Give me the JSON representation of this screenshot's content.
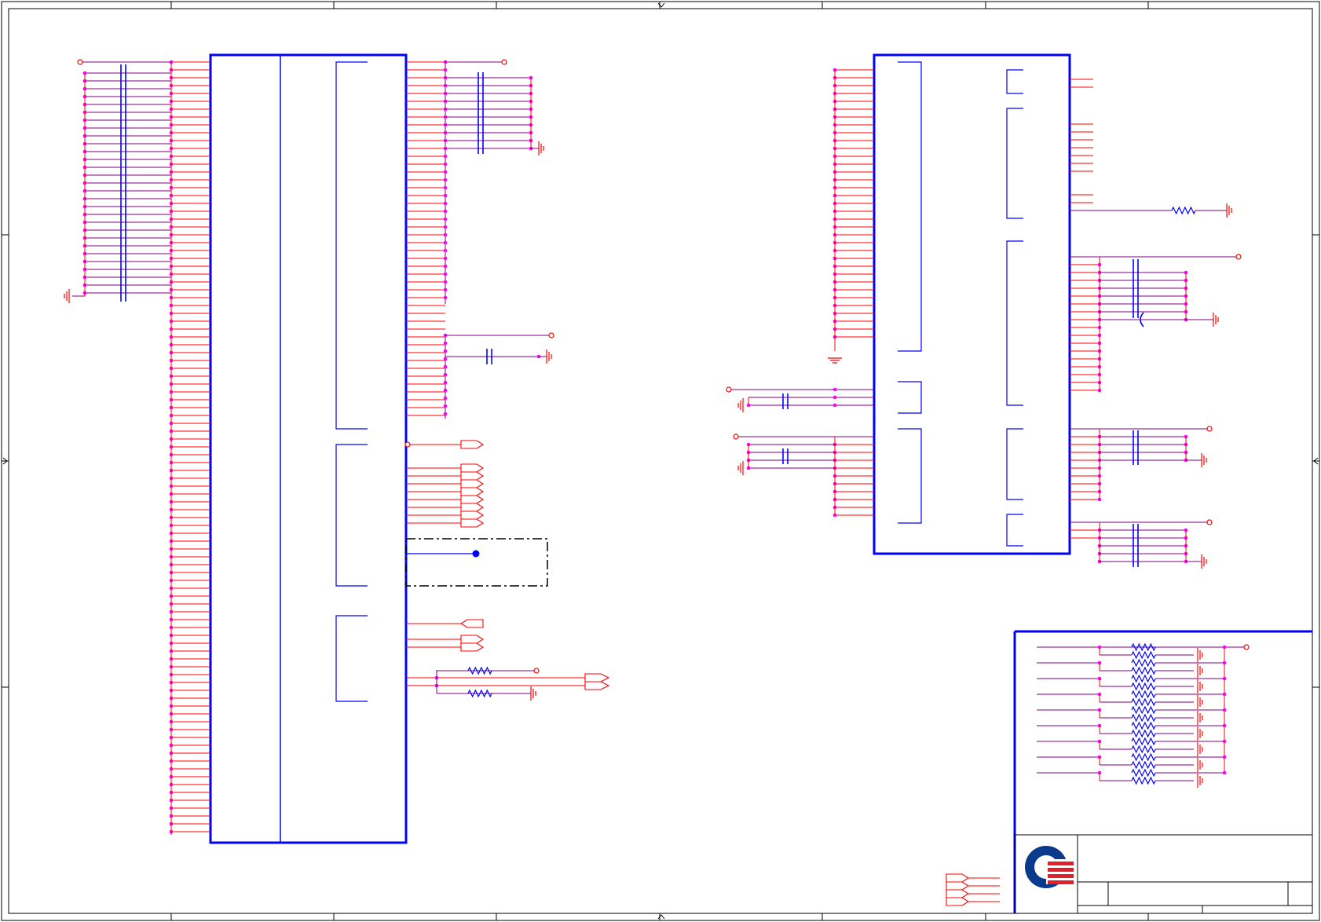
{
  "sheet": {
    "frame_color": "#000000",
    "wire_color": "#ff0000",
    "net_color": "#800080",
    "part_color": "#0000ff",
    "junction_color": "#ff00ff"
  },
  "logo": {
    "icon": "quanta-logo-icon",
    "outer_color": "#0a3a8c",
    "stripe_color": "#e0202a"
  },
  "title_block": {
    "title": "",
    "size": "",
    "document_number": "",
    "rev": "",
    "date": "",
    "sheet": ""
  }
}
